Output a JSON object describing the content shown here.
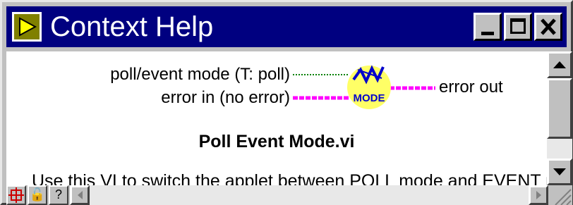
{
  "window": {
    "title": "Context Help"
  },
  "titlebar_buttons": [
    {
      "name": "minimize-button",
      "icon": "minimize-icon"
    },
    {
      "name": "maximize-button",
      "icon": "maximize-icon"
    },
    {
      "name": "close-button",
      "icon": "close-icon"
    }
  ],
  "connector": {
    "inputs": [
      {
        "label": "poll/event mode (T: poll)",
        "wire": "boolean",
        "wire_color": "#008000"
      },
      {
        "label": "error in (no error)",
        "wire": "cluster",
        "wire_color": "#ff00ff"
      }
    ],
    "outputs": [
      {
        "label": "error out",
        "wire": "cluster",
        "wire_color": "#ff00ff"
      }
    ],
    "vi_icon": {
      "text": "MODE",
      "name": "poll-event-mode-vi-icon",
      "fill": "#ffff66",
      "text_color": "#0000cc"
    }
  },
  "vi_name": "Poll Event Mode.vi",
  "description": "Use this VI to switch the applet between POLL mode and EVENT mode.",
  "bottom_buttons": [
    {
      "name": "show-connector-button",
      "icon": "connector-icon"
    },
    {
      "name": "lock-button",
      "icon": "lock-icon",
      "glyph": "🔓"
    },
    {
      "name": "help-button",
      "icon": "help-icon",
      "glyph": "?"
    }
  ],
  "colors": {
    "titlebar": "#000080",
    "chrome": "#c0c0c0",
    "content": "#ffffff"
  }
}
